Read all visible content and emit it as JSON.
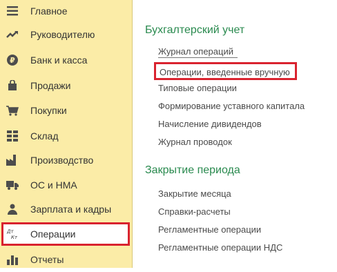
{
  "sidebar": {
    "items": [
      {
        "label": "Главное",
        "icon": "hamburger-menu-icon"
      },
      {
        "label": "Руководителю",
        "icon": "trend-up-icon"
      },
      {
        "label": "Банк и касса",
        "icon": "ruble-coin-icon"
      },
      {
        "label": "Продажи",
        "icon": "shopping-bag-icon"
      },
      {
        "label": "Покупки",
        "icon": "shopping-cart-icon"
      },
      {
        "label": "Склад",
        "icon": "warehouse-grid-icon"
      },
      {
        "label": "Производство",
        "icon": "factory-icon"
      },
      {
        "label": "ОС и НМА",
        "icon": "truck-icon"
      },
      {
        "label": "Зарплата и кадры",
        "icon": "person-icon"
      },
      {
        "label": "Операции",
        "icon": "dt-kt-icon",
        "icon_text_top": "Дт",
        "icon_text_bottom": "Кт",
        "active": true
      },
      {
        "label": "Отчеты",
        "icon": "bar-chart-icon"
      }
    ]
  },
  "sections": [
    {
      "title": "Бухгалтерский учет",
      "links": [
        "Журнал операций",
        "Операции, введенные вручную",
        "Типовые операции",
        "Формирование уставного капитала",
        "Начисление дивидендов",
        "Журнал проводок"
      ]
    },
    {
      "title": "Закрытие периода",
      "links": [
        "Закрытие месяца",
        "Справки-расчеты",
        "Регламентные операции",
        "Регламентные операции НДС"
      ]
    }
  ],
  "colors": {
    "sidebar_bg": "#fbeca7",
    "highlight_border": "#d9232f",
    "section_title": "#2a8a4f",
    "link_text": "#4a4a4a",
    "icon": "#4d4d4d"
  }
}
